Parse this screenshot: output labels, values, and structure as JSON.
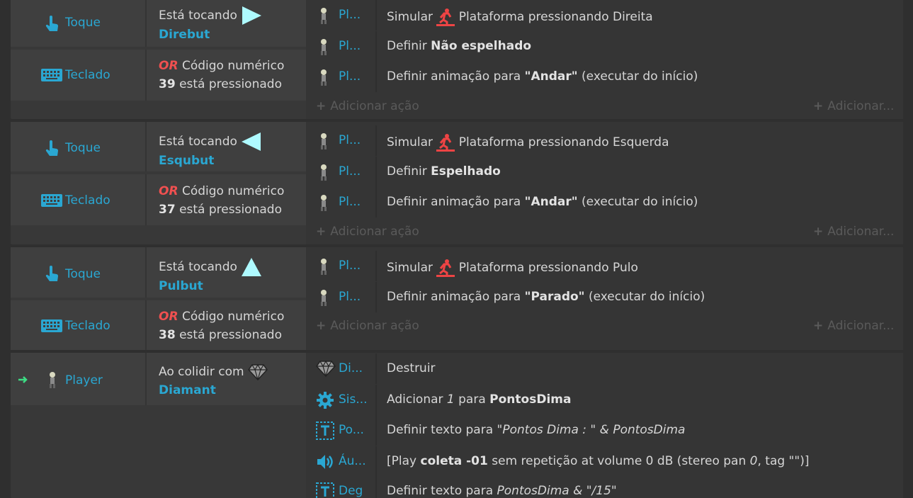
{
  "events": [
    {
      "touch_label": "Toque",
      "touch_text": "Está tocando",
      "touch_object": "Direbut",
      "key_label": "Teclado",
      "or": "OR",
      "key_text": "Código numérico",
      "key_code": "39",
      "key_suffix": "está pressionado",
      "actions": [
        {
          "obj": "Pl...",
          "a": "Simular",
          "b": "Plataforma pressionando Direita"
        },
        {
          "obj": "Pl...",
          "a": "Definir",
          "bold": "Não espelhado"
        },
        {
          "obj": "Pl...",
          "a": "Definir animação para",
          "bold": "\"Andar\"",
          "c": "(executar do início)"
        }
      ]
    },
    {
      "touch_label": "Toque",
      "touch_text": "Está tocando",
      "touch_object": "Esqubut",
      "key_label": "Teclado",
      "or": "OR",
      "key_text": "Código numérico",
      "key_code": "37",
      "key_suffix": "está pressionado",
      "actions": [
        {
          "obj": "Pl...",
          "a": "Simular",
          "b": "Plataforma pressionando Esquerda"
        },
        {
          "obj": "Pl...",
          "a": "Definir",
          "bold": "Espelhado"
        },
        {
          "obj": "Pl...",
          "a": "Definir animação para",
          "bold": "\"Andar\"",
          "c": "(executar do início)"
        }
      ]
    },
    {
      "touch_label": "Toque",
      "touch_text": "Está tocando",
      "touch_object": "Pulbut",
      "key_label": "Teclado",
      "or": "OR",
      "key_text": "Código numérico",
      "key_code": "38",
      "key_suffix": "está pressionado",
      "actions": [
        {
          "obj": "Pl...",
          "a": "Simular",
          "b": "Plataforma pressionando Pulo"
        },
        {
          "obj": "Pl...",
          "a": "Definir animação para",
          "bold": "\"Parado\"",
          "c": "(executar do início)"
        }
      ]
    }
  ],
  "collision_event": {
    "obj_label": "Player",
    "cond_text": "Ao colidir com",
    "cond_object": "Diamant",
    "actions": [
      {
        "obj": "Di...",
        "a": "Destruir"
      },
      {
        "obj": "Sis...",
        "a": "Adicionar",
        "ital": "1",
        "a2": "para",
        "bold": "PontosDima"
      },
      {
        "obj": "Po...",
        "a": "Definir texto para",
        "ital": "\"Pontos Dima : \" & PontosDima"
      },
      {
        "obj": "Áu...",
        "a": "[Play",
        "bold": "coleta -01",
        "a2": "sem repetição at volume 0 dB (stereo pan",
        "ital": "0",
        "a3": ", tag \"\")]"
      },
      {
        "obj": "Deg",
        "a": "Definir texto para",
        "ital": "PontosDima & \"/15\""
      }
    ]
  },
  "add_action_label": "Adicionar ação",
  "add_more_label": "Adicionar...",
  "colors": {
    "accent": "#2aa7d2",
    "or": "#f05050",
    "simulate_icon": "#ee4444",
    "arrow": "#3ddc84"
  }
}
